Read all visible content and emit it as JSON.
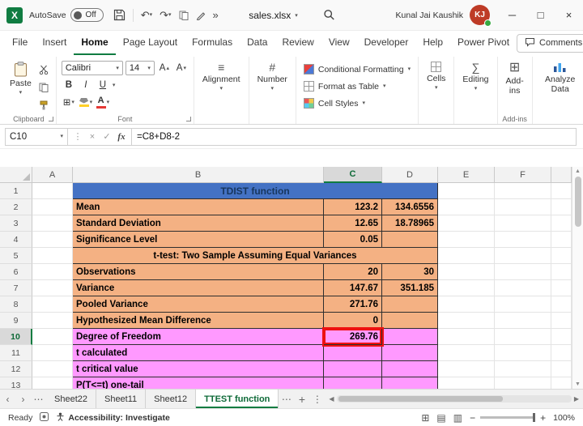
{
  "titlebar": {
    "autosave_label": "AutoSave",
    "autosave_state": "Off",
    "filename": "sales.xlsx",
    "user_name": "Kunal Jai Kaushik",
    "user_initials": "KJ"
  },
  "menubar": {
    "tabs": {
      "file": "File",
      "insert": "Insert",
      "home": "Home",
      "page_layout": "Page Layout",
      "formulas": "Formulas",
      "data": "Data",
      "review": "Review",
      "view": "View",
      "developer": "Developer",
      "help": "Help",
      "power_pivot": "Power Pivot"
    },
    "comments_label": "Comments"
  },
  "ribbon": {
    "paste_label": "Paste",
    "font_name": "Calibri",
    "font_size": "14",
    "bold_label": "B",
    "italic_label": "I",
    "underline_label": "U",
    "alignment_label": "Alignment",
    "number_label": "Number",
    "conditional_formatting_label": "Conditional Formatting",
    "format_as_table_label": "Format as Table",
    "cell_styles_label": "Cell Styles",
    "cells_label": "Cells",
    "editing_label": "Editing",
    "addins_label": "Add-ins",
    "analyze_data_label": "Analyze Data",
    "groups": {
      "clipboard": "Clipboard",
      "font": "Font",
      "addins": "Add-ins"
    }
  },
  "formula_bar": {
    "name_box": "C10",
    "fx_label": "fx",
    "formula": "=C8+D8-2"
  },
  "grid": {
    "columns": {
      "a": "A",
      "b": "B",
      "c": "C",
      "d": "D",
      "e": "E",
      "f": "F"
    },
    "active_cell": "C10",
    "rows": [
      {
        "num": "1",
        "label": "TDIST function"
      },
      {
        "num": "2",
        "label": "Mean",
        "c": "123.2",
        "d": "134.6556"
      },
      {
        "num": "3",
        "label": "Standard Deviation",
        "c": "12.65",
        "d": "18.78965"
      },
      {
        "num": "4",
        "label": "Significance Level",
        "c": "0.05",
        "d": ""
      },
      {
        "num": "5",
        "label": "t-test: Two Sample Assuming Equal Variances"
      },
      {
        "num": "6",
        "label": "Observations",
        "c": "20",
        "d": "30"
      },
      {
        "num": "7",
        "label": "Variance",
        "c": "147.67",
        "d": "351.185"
      },
      {
        "num": "8",
        "label": "Pooled Variance",
        "c": "271.76",
        "d": ""
      },
      {
        "num": "9",
        "label": "Hypothesized Mean Difference",
        "c": "0",
        "d": ""
      },
      {
        "num": "10",
        "label": "Degree of Freedom",
        "c": "269.76",
        "d": ""
      },
      {
        "num": "11",
        "label": "t calculated",
        "c": "",
        "d": ""
      },
      {
        "num": "12",
        "label": "t critical value",
        "c": "",
        "d": ""
      },
      {
        "num": "13",
        "label": "P(T<=t) one-tail",
        "c": "",
        "d": ""
      }
    ]
  },
  "sheet_tabs": {
    "tab1": "Sheet22",
    "tab2": "Sheet11",
    "tab3": "Sheet12",
    "tab4": "TTEST function",
    "active": "TTEST function"
  },
  "status_bar": {
    "mode": "Ready",
    "accessibility_label": "Accessibility: Investigate",
    "zoom": "100%"
  },
  "colors": {
    "excel_green": "#107C41",
    "table_header_blue": "#4472C4",
    "table_orange": "#F4B183",
    "table_pink": "#FF99FF",
    "highlight_red": "#EE1111",
    "avatar_red": "#BE3B26"
  }
}
